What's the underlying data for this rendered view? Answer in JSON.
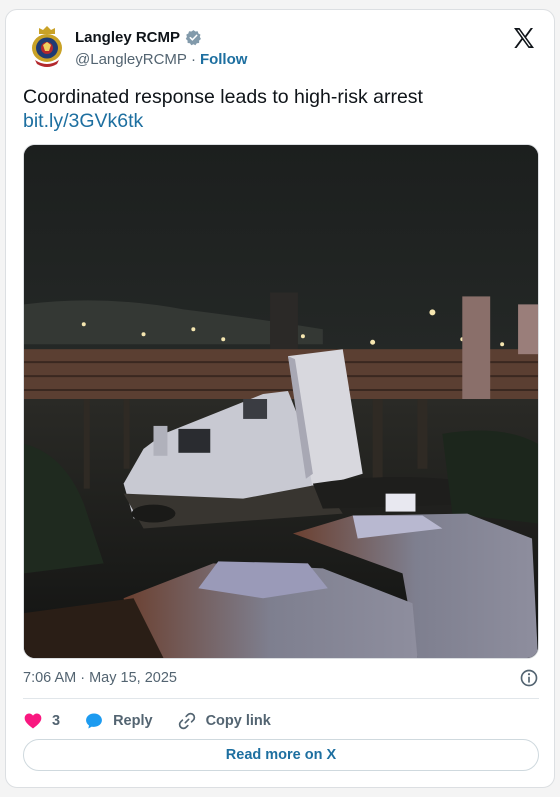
{
  "author": {
    "display_name": "Langley RCMP",
    "handle": "@LangleyRCMP",
    "separator": "·",
    "follow_label": "Follow",
    "verified": true
  },
  "post": {
    "text": "Coordinated response leads to high-risk arrest",
    "link": "bit.ly/3GVk6tk",
    "timestamp": "7:06 AM · May 15, 2025"
  },
  "actions": {
    "like_count": "3",
    "reply_label": "Reply",
    "copy_link_label": "Copy link"
  },
  "footer": {
    "read_more_label": "Read more on X"
  },
  "colors": {
    "link": "#1d6fa0",
    "heart": "#f91880",
    "verified": "#829aab",
    "reply_bubble": "#1d9bf0"
  },
  "icons": [
    "rcmp-badge-icon",
    "verified-icon",
    "x-logo-icon",
    "info-icon",
    "heart-icon",
    "reply-icon",
    "link-icon"
  ]
}
